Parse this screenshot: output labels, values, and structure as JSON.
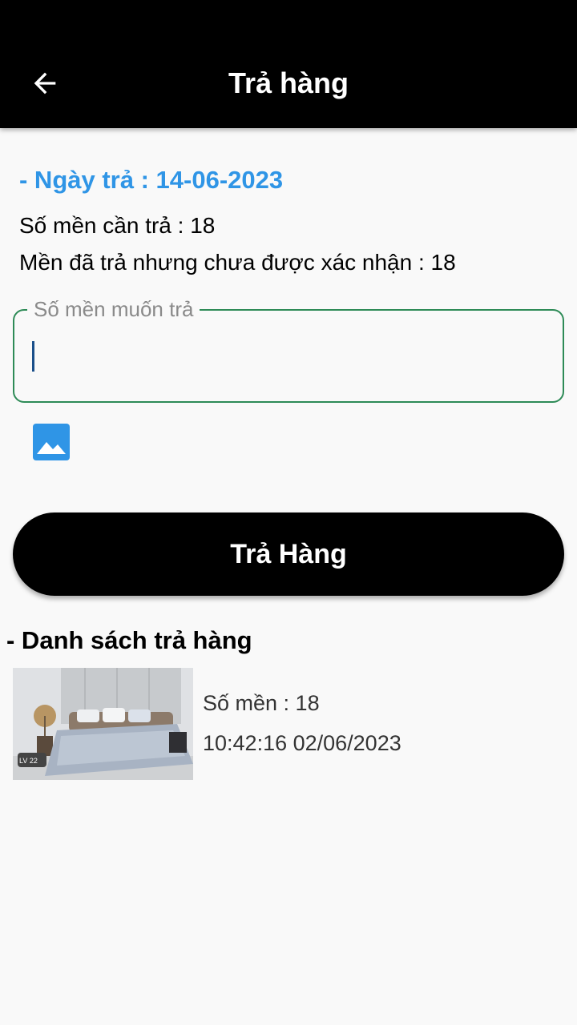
{
  "appbar": {
    "title": "Trả hàng"
  },
  "return_date": "- Ngày trả : 14-06-2023",
  "need_return": "Số mền cần trả : 18",
  "unconfirmed": "Mền đã trả nhưng chưa được xác nhận : 18",
  "quantity_field": {
    "label": "Số mền muốn trả",
    "value": ""
  },
  "submit_label": "Trả Hàng",
  "section_title": "- Danh sách trả hàng",
  "returns": [
    {
      "thumb_caption": "LV 22",
      "quantity": "Số mền : 18",
      "time": "10:42:16 02/06/2023"
    }
  ],
  "colors": {
    "accent": "#2f95e6",
    "field_border": "#2e8b57",
    "button": "#000000"
  }
}
